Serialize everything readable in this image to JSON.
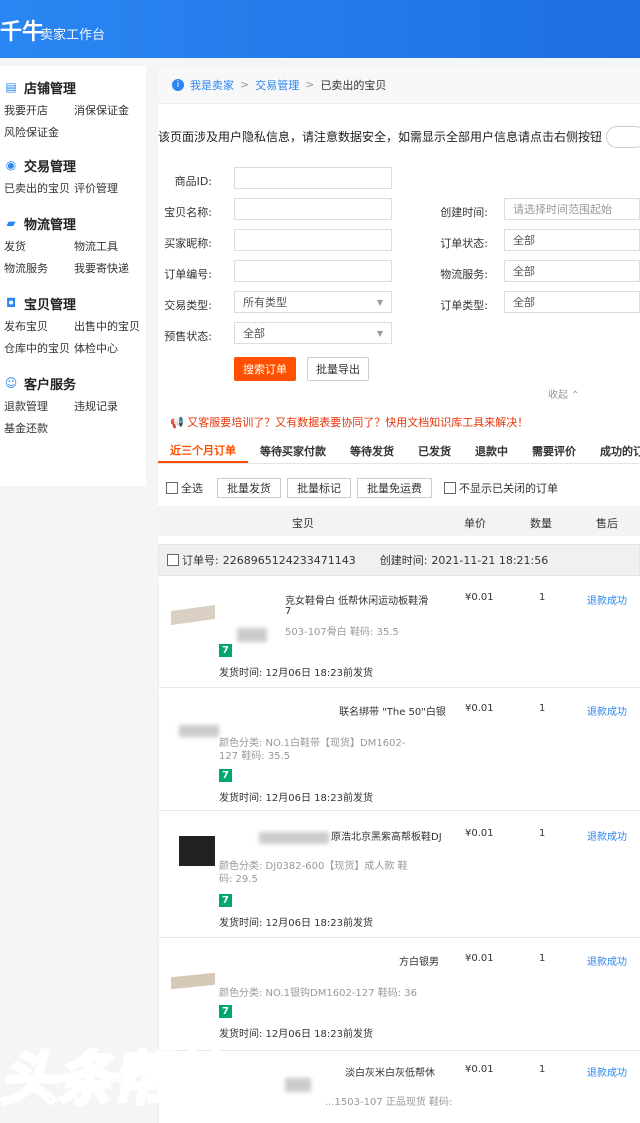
{
  "topbar": {
    "logo": "千牛",
    "subtitle": "卖家工作台"
  },
  "sidebar": {
    "sections": [
      {
        "icon": "store-icon",
        "title": "店铺管理",
        "items": [
          "我要开店",
          "消保保证金",
          "风险保证金"
        ]
      },
      {
        "icon": "trade-icon",
        "title": "交易管理",
        "items": [
          "已卖出的宝贝",
          "评价管理"
        ]
      },
      {
        "icon": "truck-icon",
        "title": "物流管理",
        "items": [
          "发货",
          "物流工具",
          "物流服务",
          "我要寄快递"
        ]
      },
      {
        "icon": "bag-icon",
        "title": "宝贝管理",
        "items": [
          "发布宝贝",
          "出售中的宝贝",
          "仓库中的宝贝",
          "体检中心"
        ]
      },
      {
        "icon": "support-icon",
        "title": "客户服务",
        "items": [
          "退款管理",
          "违规记录",
          "基金还款"
        ]
      }
    ]
  },
  "breadcrumb": {
    "l1": "我是卖家",
    "l2": "交易管理",
    "l3": "已卖出的宝贝"
  },
  "notice": "该页面涉及用户隐私信息，请注意数据安全，如需显示全部用户信息请点击右侧按钮",
  "form": {
    "product_id": {
      "label": "商品ID:",
      "value": ""
    },
    "item_name": {
      "label": "宝贝名称:",
      "value": ""
    },
    "buyer_nick": {
      "label": "买家昵称:",
      "value": ""
    },
    "order_no": {
      "label": "订单编号:",
      "value": ""
    },
    "trade_type": {
      "label": "交易类型:",
      "value": "所有类型"
    },
    "presale": {
      "label": "预售状态:",
      "value": "全部"
    },
    "created": {
      "label": "创建时间:",
      "placeholder": "请选择时间范围起始"
    },
    "order_status": {
      "label": "订单状态:",
      "value": "全部"
    },
    "logistics": {
      "label": "物流服务:",
      "value": "全部"
    },
    "order_type": {
      "label": "订单类型:",
      "value": "全部"
    },
    "search_btn": "搜索订单",
    "export_btn": "批量导出",
    "collapse": "收起"
  },
  "promo": "又客服要培训了？又有数据表要协同了？快用文档知识库工具来解决！",
  "tabs": [
    "近三个月订单",
    "等待买家付款",
    "等待发货",
    "已发货",
    "退款中",
    "需要评价",
    "成功的订单"
  ],
  "bulk": {
    "select_all": "全选",
    "ship": "批量发货",
    "mark": "批量标记",
    "free": "批量免运费",
    "hide_closed": "不显示已关闭的订单"
  },
  "table": {
    "col_item": "宝贝",
    "col_price": "单价",
    "col_qty": "数量",
    "col_after": "售后"
  },
  "order": {
    "no_label": "订单号:",
    "no": "2268965124233471143",
    "created_label": "创建时间:",
    "created": "2021-11-21 18:21:56"
  },
  "rows": [
    {
      "title": "克女鞋骨白 低帮休闲运动板鞋滑",
      "title2": "7",
      "spec": "503-107骨白 鞋码: 35.5",
      "badge": "7",
      "ship": "发货时间: 12月06日 18:23前发货",
      "price": "¥0.01",
      "qty": "1",
      "status": "退款成功"
    },
    {
      "title": "联名绑带 \"The 50\"白银",
      "title2": "",
      "spec": "颜色分类: NO.1白鞋带【现货】DM1602-127 鞋码: 35.5",
      "badge": "7",
      "ship": "发货时间: 12月06日 18:23前发货",
      "price": "¥0.01",
      "qty": "1",
      "status": "退款成功"
    },
    {
      "title": "原浩北京黑紫高帮板鞋DJ",
      "title2": "",
      "spec": "颜色分类: DJ0382-600【现货】成人款 鞋码: 29.5",
      "badge": "7",
      "ship": "发货时间: 12月06日 18:23前发货",
      "price": "¥0.01",
      "qty": "1",
      "status": "退款成功"
    },
    {
      "title": "方白银男",
      "title2": "",
      "spec": "颜色分类: NO.1银钩DM1602-127 鞋码: 36",
      "badge": "7",
      "ship": "发货时间: 12月06日 18:23前发货",
      "price": "¥0.01",
      "qty": "1",
      "status": "退款成功"
    },
    {
      "title": "淡白灰米白灰低帮休",
      "title2": "",
      "spec": "...1503-107 正品现货 鞋码:",
      "badge": "",
      "ship": "",
      "price": "¥0.01",
      "qty": "1",
      "status": "退款成功"
    }
  ],
  "watermark": "头条帮忙"
}
